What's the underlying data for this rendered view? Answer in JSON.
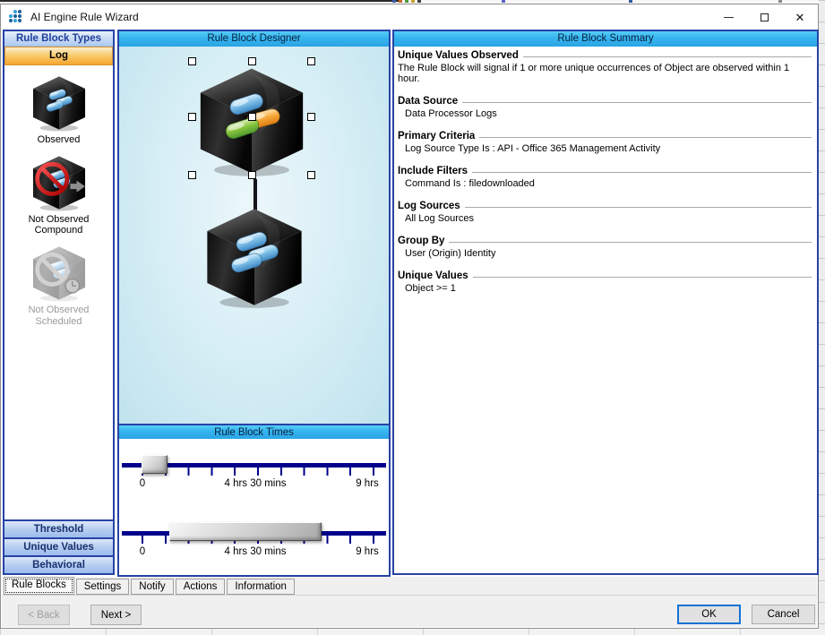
{
  "window": {
    "title": "AI Engine Rule Wizard",
    "close_glyph": "✕"
  },
  "colors": {
    "header_cyan": "#36b4ee",
    "selected_orange": "#f5a62e",
    "panel_border_blue": "#2743a6",
    "slider_track_navy": "#00008b",
    "ok_default_border": "#1273d4",
    "logo_blue_dark": "#1c5e9e",
    "logo_blue_light": "#2f9fd8"
  },
  "rule_block_types": {
    "header": "Rule Block Types",
    "selected_type": "Log",
    "items": [
      {
        "label": "Observed",
        "icon": "observed-cube-icon",
        "enabled": true
      },
      {
        "label": "Not Observed Compound",
        "icon": "not-observed-compound-icon",
        "enabled": true
      },
      {
        "label": "Not Observed Scheduled",
        "icon": "not-observed-scheduled-icon",
        "enabled": false
      }
    ],
    "type_buttons": [
      {
        "label": "Threshold"
      },
      {
        "label": "Unique Values"
      },
      {
        "label": "Behavioral"
      }
    ]
  },
  "designer": {
    "header": "Rule Block Designer"
  },
  "times": {
    "header": "Rule Block Times",
    "sliders": [
      {
        "labels": [
          "0",
          "4 hrs 30 mins",
          "9 hrs"
        ]
      },
      {
        "labels": [
          "0",
          "4 hrs 30 mins",
          "9 hrs"
        ]
      }
    ]
  },
  "summary": {
    "header": "Rule Block Summary",
    "sections": [
      {
        "title": "Unique Values Observed",
        "content": "The Rule Block will signal if 1 or more unique occurrences of Object are observed within 1 hour."
      },
      {
        "title": "Data Source",
        "content": "Data Processor Logs"
      },
      {
        "title": "Primary Criteria",
        "content": "Log Source Type Is : API - Office 365 Management Activity"
      },
      {
        "title": "Include Filters",
        "content": "Command Is : filedownloaded"
      },
      {
        "title": "Log Sources",
        "content": "All Log Sources"
      },
      {
        "title": "Group By",
        "content": "User (Origin) Identity"
      },
      {
        "title": "Unique Values",
        "content": "Object >= 1"
      }
    ]
  },
  "tabs": [
    {
      "label": "Rule Blocks",
      "active": true
    },
    {
      "label": "Settings",
      "active": false
    },
    {
      "label": "Notify",
      "active": false
    },
    {
      "label": "Actions",
      "active": false
    },
    {
      "label": "Information",
      "active": false
    }
  ],
  "wizard_buttons": {
    "back": "< Back",
    "next": "Next >",
    "ok": "OK",
    "cancel": "Cancel"
  }
}
